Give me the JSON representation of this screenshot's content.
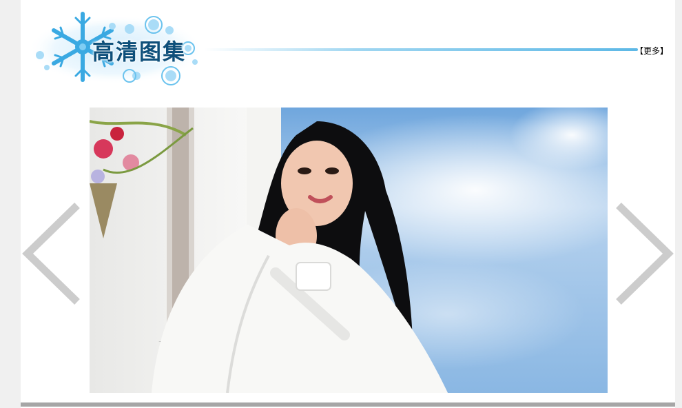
{
  "section": {
    "title": "高清图集",
    "more_label": "【更多】"
  },
  "gallery": {
    "prev_icon": "chevron-left-icon",
    "next_icon": "chevron-right-icon"
  },
  "colors": {
    "title_text": "#0e4f7a",
    "snowflake": "#4fb6e8",
    "title_line": "#5db8e6",
    "arrow": "#cccccc",
    "footer_bar": "#a6a6a6"
  }
}
